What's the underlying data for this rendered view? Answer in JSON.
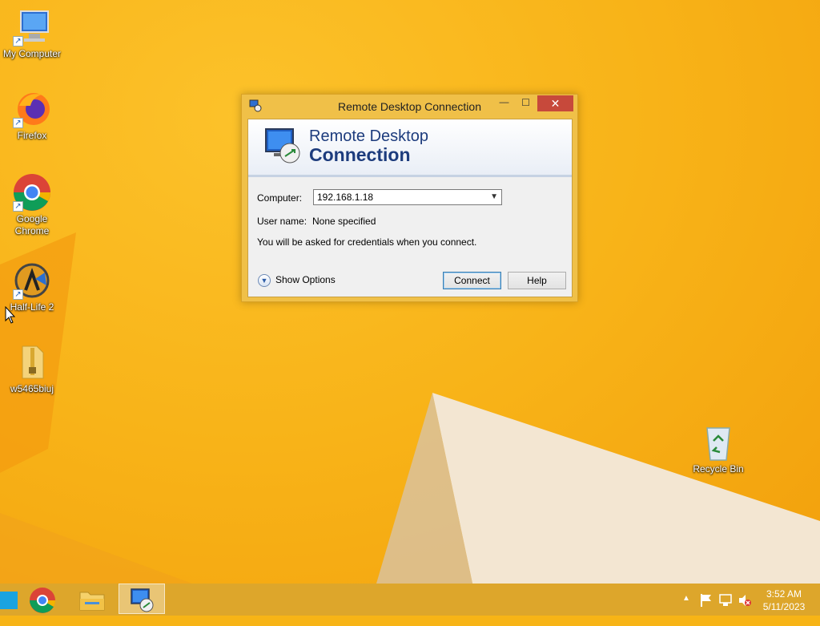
{
  "desktop": {
    "icons": [
      {
        "label": "My Computer",
        "icon": "computer-icon"
      },
      {
        "label": "Firefox",
        "icon": "firefox-icon"
      },
      {
        "label": "Google Chrome",
        "icon": "chrome-icon"
      },
      {
        "label": "Half-Life 2",
        "icon": "halflife2-icon"
      },
      {
        "label": "w5465biuj",
        "icon": "zip-folder-icon"
      },
      {
        "label": "Recycle Bin",
        "icon": "recycle-bin-icon"
      }
    ]
  },
  "dialog": {
    "title": "Remote Desktop Connection",
    "banner_line1": "Remote Desktop",
    "banner_line2": "Connection",
    "computer_label": "Computer:",
    "computer_value": "192.168.1.18",
    "username_label": "User name:",
    "username_value": "None specified",
    "info_text": "You will be asked for credentials when you connect.",
    "show_options": "Show Options",
    "connect_label": "Connect",
    "help_label": "Help",
    "close_glyph": "✕",
    "min_glyph": "—",
    "max_glyph": "☐"
  },
  "taskbar": {
    "time": "3:52 AM",
    "date": "5/11/2023",
    "items": [
      "start-icon",
      "chrome-icon",
      "file-explorer-icon",
      "remote-desktop-icon"
    ]
  },
  "colors": {
    "desktop": "#f7b416",
    "taskbar": "#dda62b",
    "dialog_frame": "#f0c048",
    "close_button": "#c7493b",
    "banner_text": "#1d3c7d"
  }
}
